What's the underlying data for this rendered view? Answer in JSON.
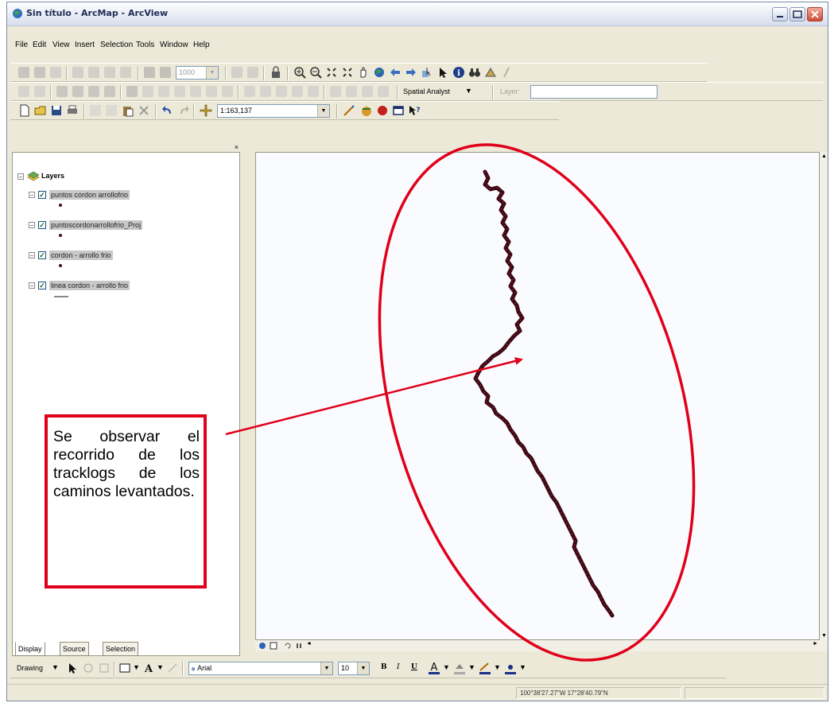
{
  "window": {
    "title": "Sin título - ArcMap - ArcView"
  },
  "menu": {
    "items": [
      "File",
      "Edit",
      "View",
      "Insert",
      "Selection",
      "Tools",
      "Window",
      "Help"
    ]
  },
  "toolbar": {
    "zoom_box": "1000",
    "spatial_analyst_label": "Spatial Analyst",
    "layer_label": "Layer:",
    "scale_value": "1:163,137",
    "font_name": "Arial",
    "font_size": "10",
    "drawing_label": "Drawing"
  },
  "toc": {
    "root_label": "Layers",
    "layers": [
      {
        "name": "puntos cordon arrollofrio",
        "checked": true
      },
      {
        "name": "puntoscordonarrollofrio_Proj",
        "checked": true
      },
      {
        "name": "cordon - arrollo frio",
        "checked": true
      },
      {
        "name": "linea cordon - arrollo frio",
        "checked": true
      }
    ],
    "tabs": [
      "Display",
      "Source",
      "Selection"
    ]
  },
  "statusbar": {
    "coordinates": "100°38'27.27\"W  17°28'40.79\"N"
  },
  "annotation": {
    "text": "Se observar el recorrido de los tracklogs de los caminos levantados."
  },
  "colors": {
    "annotation_red": "#e0001a",
    "track": "#3a0812",
    "map_bg": "#f9fbff",
    "chrome": "#ece9d8"
  }
}
